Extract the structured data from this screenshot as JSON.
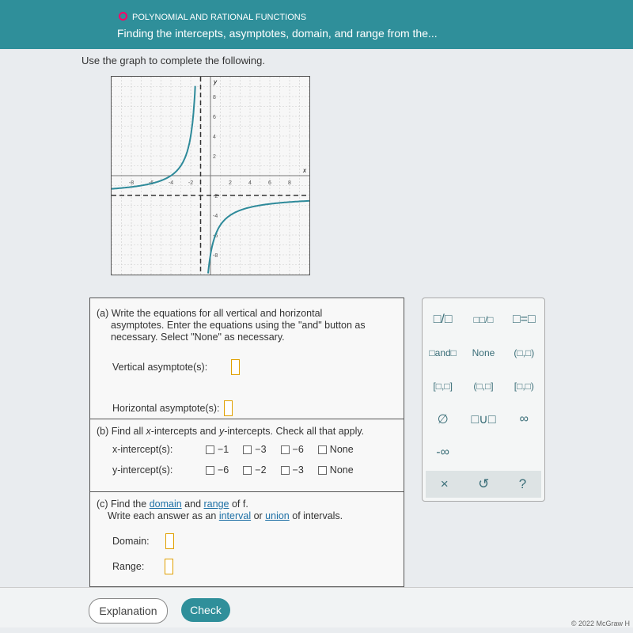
{
  "header": {
    "topic": "POLYNOMIAL AND RATIONAL FUNCTIONS",
    "title": "Finding the intercepts, asymptotes, domain, and range from the..."
  },
  "instruction": "Use the graph to complete the following.",
  "graph": {
    "xlabel": "x",
    "ylabel": "y",
    "xticks": [
      "-8",
      "-6",
      "-4",
      "-2",
      "2",
      "4",
      "6",
      "8"
    ],
    "yticks": [
      "8",
      "6",
      "4",
      "2",
      "-2",
      "-4",
      "-6",
      "-8"
    ],
    "xrange": [
      -10,
      10
    ],
    "yrange": [
      -10,
      10
    ],
    "vertical_asymptote": -1,
    "horizontal_asymptote": -2,
    "curve_color": "#2e8a9a"
  },
  "part_a": {
    "prompt1": "(a) Write the equations for all vertical and horizontal",
    "prompt2": "asymptotes. Enter the equations using the \"and\" button as",
    "prompt3": "necessary. Select \"None\" as necessary.",
    "vertical_label": "Vertical asymptote(s):",
    "horizontal_label": "Horizontal asymptote(s):"
  },
  "part_b": {
    "prompt_pre": "(b) Find all ",
    "prompt_mid": "-intercepts and ",
    "prompt_post": "-intercepts. Check all that apply.",
    "x": "x",
    "y": "y",
    "x_label": "x-intercept(s):",
    "x_options": [
      "−1",
      "−3",
      "−6",
      "None"
    ],
    "y_label": "y-intercept(s):",
    "y_options": [
      "−6",
      "−2",
      "−3",
      "None"
    ]
  },
  "part_c": {
    "pre": "(c) Find the ",
    "domain": "domain",
    "and": " and ",
    "range": "range",
    "post": " of f.",
    "line2_pre": "Write each answer as an ",
    "interval": "interval",
    "or": " or ",
    "union": "union",
    "line2_post": " of intervals.",
    "domain_label": "Domain:",
    "range_label": "Range:"
  },
  "keypad": {
    "keys": [
      "□/□",
      "□□/□",
      "□=□",
      "□and□",
      "None",
      "(□,□)",
      "[□,□]",
      "(□,□]",
      "[□,□)",
      "∅",
      "□∪□",
      "∞",
      "-∞"
    ],
    "clear": "×",
    "undo": "↺",
    "help": "?"
  },
  "footer": {
    "explanation": "Explanation",
    "check": "Check",
    "copyright": "© 2022 McGraw H"
  }
}
